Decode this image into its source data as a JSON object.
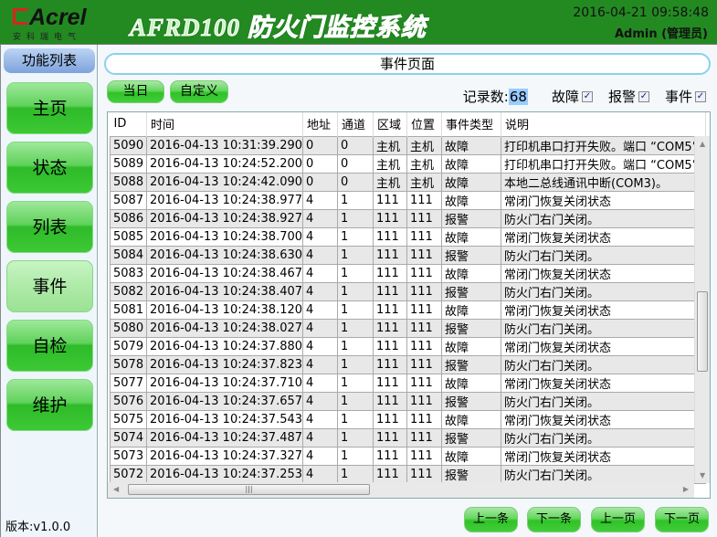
{
  "header": {
    "logo_text": "Acrel",
    "logo_sub": "安科瑞电气",
    "title": "AFRD100 防火门监控系统",
    "datetime": "2016-04-21 09:58:48",
    "user": "Admin (管理员)"
  },
  "sidebar": {
    "title": "功能列表",
    "items": [
      {
        "label": "主页"
      },
      {
        "label": "状态"
      },
      {
        "label": "列表"
      },
      {
        "label": "事件",
        "active": true
      },
      {
        "label": "自检"
      },
      {
        "label": "维护"
      }
    ],
    "version": "版本:v1.0.0"
  },
  "main": {
    "page_title": "事件页面",
    "today_label": "当日",
    "custom_label": "自定义",
    "record_count_label": "记录数:",
    "record_count": "68",
    "filters": [
      {
        "label": "故障",
        "checked": true
      },
      {
        "label": "报警",
        "checked": true
      },
      {
        "label": "事件",
        "checked": true
      }
    ]
  },
  "table": {
    "columns": [
      "ID",
      "时间",
      "地址",
      "通道",
      "区域",
      "位置",
      "事件类型",
      "说明"
    ],
    "rows": [
      [
        "5090",
        "2016-04-13 10:31:39.290",
        "0",
        "0",
        "主机",
        "主机",
        "故障",
        "打印机串口打开失败。端口 “COM5”"
      ],
      [
        "5089",
        "2016-04-13 10:24:52.200",
        "0",
        "0",
        "主机",
        "主机",
        "故障",
        "打印机串口打开失败。端口 “COM5”"
      ],
      [
        "5088",
        "2016-04-13 10:24:42.090",
        "0",
        "0",
        "主机",
        "主机",
        "故障",
        "本地二总线通讯中断(COM3)。"
      ],
      [
        "5087",
        "2016-04-13 10:24:38.977",
        "4",
        "1",
        "111",
        "111",
        "故障",
        "常闭门恢复关闭状态"
      ],
      [
        "5086",
        "2016-04-13 10:24:38.927",
        "4",
        "1",
        "111",
        "111",
        "报警",
        "防火门右门关闭。"
      ],
      [
        "5085",
        "2016-04-13 10:24:38.700",
        "4",
        "1",
        "111",
        "111",
        "故障",
        "常闭门恢复关闭状态"
      ],
      [
        "5084",
        "2016-04-13 10:24:38.630",
        "4",
        "1",
        "111",
        "111",
        "报警",
        "防火门右门关闭。"
      ],
      [
        "5083",
        "2016-04-13 10:24:38.467",
        "4",
        "1",
        "111",
        "111",
        "故障",
        "常闭门恢复关闭状态"
      ],
      [
        "5082",
        "2016-04-13 10:24:38.407",
        "4",
        "1",
        "111",
        "111",
        "报警",
        "防火门右门关闭。"
      ],
      [
        "5081",
        "2016-04-13 10:24:38.120",
        "4",
        "1",
        "111",
        "111",
        "故障",
        "常闭门恢复关闭状态"
      ],
      [
        "5080",
        "2016-04-13 10:24:38.027",
        "4",
        "1",
        "111",
        "111",
        "报警",
        "防火门右门关闭。"
      ],
      [
        "5079",
        "2016-04-13 10:24:37.880",
        "4",
        "1",
        "111",
        "111",
        "故障",
        "常闭门恢复关闭状态"
      ],
      [
        "5078",
        "2016-04-13 10:24:37.823",
        "4",
        "1",
        "111",
        "111",
        "报警",
        "防火门右门关闭。"
      ],
      [
        "5077",
        "2016-04-13 10:24:37.710",
        "4",
        "1",
        "111",
        "111",
        "故障",
        "常闭门恢复关闭状态"
      ],
      [
        "5076",
        "2016-04-13 10:24:37.657",
        "4",
        "1",
        "111",
        "111",
        "报警",
        "防火门右门关闭。"
      ],
      [
        "5075",
        "2016-04-13 10:24:37.543",
        "4",
        "1",
        "111",
        "111",
        "故障",
        "常闭门恢复关闭状态"
      ],
      [
        "5074",
        "2016-04-13 10:24:37.487",
        "4",
        "1",
        "111",
        "111",
        "报警",
        "防火门右门关闭。"
      ],
      [
        "5073",
        "2016-04-13 10:24:37.327",
        "4",
        "1",
        "111",
        "111",
        "故障",
        "常闭门恢复关闭状态"
      ],
      [
        "5072",
        "2016-04-13 10:24:37.253",
        "4",
        "1",
        "111",
        "111",
        "报警",
        "防火门右门关闭。"
      ]
    ]
  },
  "pager": {
    "prev_item": "上一条",
    "next_item": "下一条",
    "prev_page": "上一页",
    "next_page": "下一页"
  }
}
